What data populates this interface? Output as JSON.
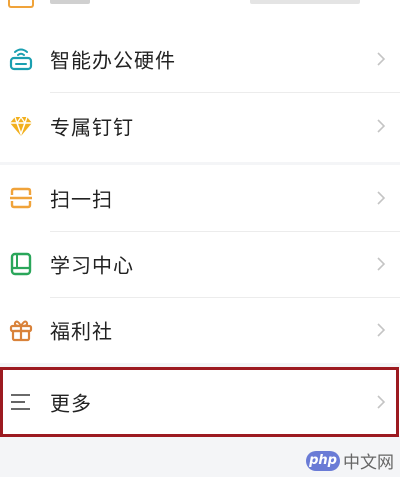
{
  "menu": {
    "group1": [
      {
        "label": "智能办公硬件",
        "icon": "router-icon"
      },
      {
        "label": "专属钉钉",
        "icon": "diamond-icon"
      }
    ],
    "group2": [
      {
        "label": "扫一扫",
        "icon": "scan-icon"
      },
      {
        "label": "学习中心",
        "icon": "book-icon"
      },
      {
        "label": "福利社",
        "icon": "gift-icon"
      }
    ],
    "group3": [
      {
        "label": "更多",
        "icon": "menu-lines-icon"
      }
    ]
  },
  "watermark": {
    "logo": "php",
    "text": "中文网"
  },
  "colors": {
    "accent_red": "#9c1a20",
    "icon_teal": "#1a9fb0",
    "icon_yellow": "#f2b01e",
    "icon_orange": "#f0a33a",
    "icon_green": "#2aa65a",
    "icon_brown": "#d9823a"
  }
}
